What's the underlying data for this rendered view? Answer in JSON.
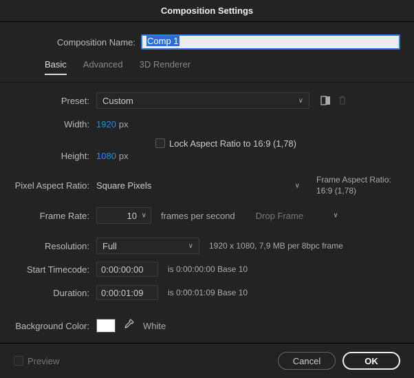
{
  "title": "Composition Settings",
  "comp_name_label": "Composition Name:",
  "comp_name_value": "Comp 1",
  "tabs": {
    "basic": "Basic",
    "advanced": "Advanced",
    "renderer": "3D Renderer"
  },
  "preset": {
    "label": "Preset:",
    "value": "Custom"
  },
  "width": {
    "label": "Width:",
    "value": "1920",
    "unit": "px"
  },
  "height": {
    "label": "Height:",
    "value": "1080",
    "unit": "px"
  },
  "lock_ar": "Lock Aspect Ratio to 16:9 (1,78)",
  "par": {
    "label": "Pixel Aspect Ratio:",
    "value": "Square Pixels"
  },
  "far": {
    "label": "Frame Aspect Ratio:",
    "value": "16:9 (1,78)"
  },
  "fps": {
    "label": "Frame Rate:",
    "value": "10",
    "unit": "frames per second",
    "drop": "Drop Frame"
  },
  "res": {
    "label": "Resolution:",
    "value": "Full",
    "info": "1920 x 1080, 7,9 MB per 8bpc frame"
  },
  "start": {
    "label": "Start Timecode:",
    "value": "0:00:00:00",
    "info": "is 0:00:00:00  Base 10"
  },
  "duration": {
    "label": "Duration:",
    "value": "0:00:01:09",
    "info": "is 0:00:01:09  Base 10"
  },
  "bg": {
    "label": "Background Color:",
    "name": "White"
  },
  "preview": "Preview",
  "cancel": "Cancel",
  "ok": "OK"
}
